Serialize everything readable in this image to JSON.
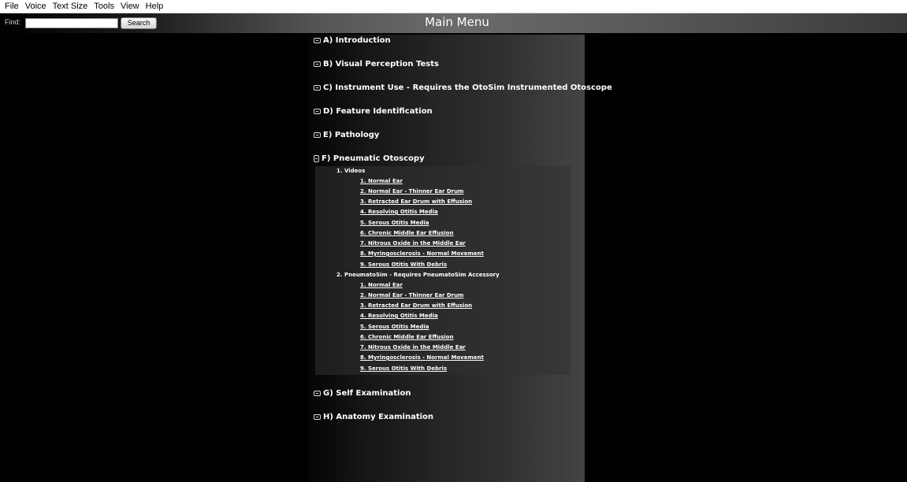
{
  "menu": [
    "File",
    "Voice",
    "Text Size",
    "Tools",
    "View",
    "Help"
  ],
  "toolbar": {
    "find_label": "Find:",
    "find_value": "",
    "search_label": "Search",
    "title": "Main Menu"
  },
  "sections": {
    "a": "A) Introduction",
    "b": "B) Visual Perception Tests",
    "c": "C) Instrument Use - Requires the OtoSim Instrumented Otoscope",
    "d": "D) Feature Identification",
    "e": "E) Pathology",
    "f": "F) Pneumatic Otoscopy",
    "g": "G) Self Examination",
    "h": "H) Anatomy Examination"
  },
  "pneumatic": {
    "videos_heading": "1. Videos",
    "videos": [
      "1. Normal Ear",
      "2. Normal Ear - Thinner Ear Drum",
      "3. Retracted Ear Drum with Effusion",
      "4. Resolving Otitis Media",
      "5. Serous Otitis Media",
      "6. Chronic Middle Ear Effusion",
      "7. Nitrous Oxide in the Middle Ear",
      "8. Myringosclerosis - Normal Movement",
      "9. Serous Otitis With Debris"
    ],
    "pneumatosim_heading": "2. PneumatoSim - Requires PneumatoSim Accessory",
    "pneumatosim": [
      "1. Normal Ear",
      "2. Normal Ear - Thinner Ear Drum",
      "3. Retracted Ear Drum with Effusion",
      "4. Resolving Otitis Media",
      "5. Serous Otitis Media",
      "6. Chronic Middle Ear Effusion",
      "7. Nitrous Oxide in the Middle Ear",
      "8. Myringosclerosis - Normal Movement",
      "9. Serous Otitis With Debris"
    ]
  }
}
